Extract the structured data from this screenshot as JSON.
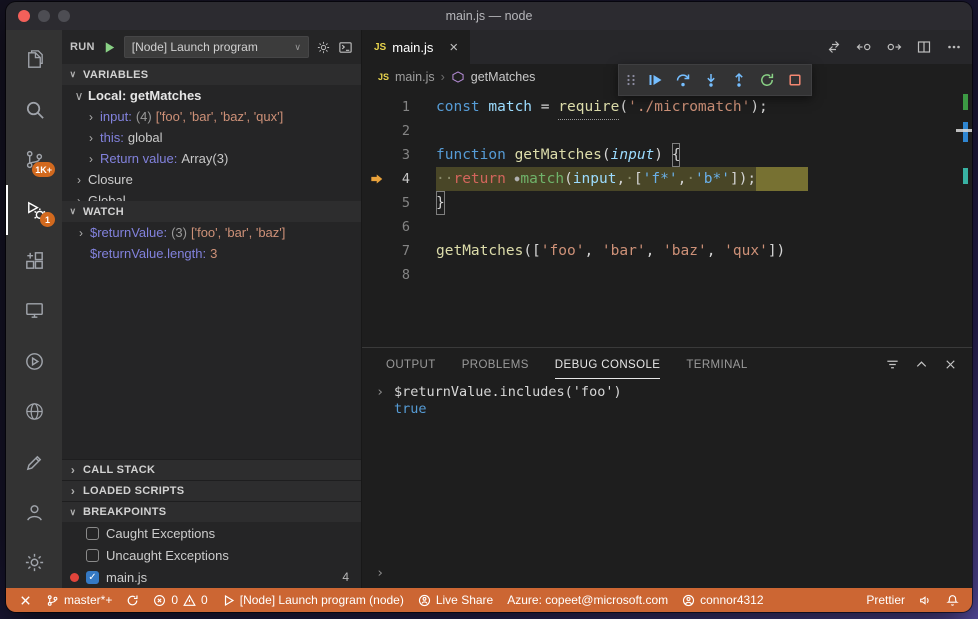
{
  "window": {
    "title": "main.js — node"
  },
  "colors": {
    "status_bar_debug": "#cc6633",
    "badge": "#d2691e",
    "current_line_highlight": "#53502a",
    "breakpoint_red": "#e0443b",
    "debug_step_blue": "#75beff",
    "restart_green": "#89d185",
    "stop_red": "#f48771"
  },
  "activity_bar": {
    "items": [
      {
        "icon": "explorer"
      },
      {
        "icon": "search"
      },
      {
        "icon": "source-control",
        "badge": "1K+"
      },
      {
        "icon": "debug",
        "badge": "1",
        "active": true
      },
      {
        "icon": "extensions"
      },
      {
        "icon": "remote-explorer"
      },
      {
        "icon": "run-circle"
      },
      {
        "icon": "globe"
      },
      {
        "icon": "edit-session"
      }
    ],
    "bottom_items": [
      {
        "icon": "account"
      },
      {
        "icon": "settings-gear"
      }
    ]
  },
  "run_bar": {
    "label": "RUN",
    "config": "[Node] Launch program"
  },
  "variables": {
    "header": "VARIABLES",
    "scope": "Local: getMatches",
    "rows": [
      {
        "name": "input:",
        "meta": "(4)",
        "value": "['foo', 'bar', 'baz', 'qux']",
        "vc": "str"
      },
      {
        "name": "this:",
        "meta": "",
        "value": "global",
        "vc": "pln"
      },
      {
        "name": "Return value:",
        "meta": "",
        "value": "Array(3)",
        "vc": "pln"
      }
    ],
    "closure": "Closure",
    "global": "Global"
  },
  "watch": {
    "header": "WATCH",
    "rows": [
      {
        "name": "$returnValue:",
        "meta": "(3)",
        "value": "['foo', 'bar', 'baz']",
        "vc": "str",
        "expandable": true
      },
      {
        "name": "$returnValue.length:",
        "meta": "",
        "value": "3",
        "vc": "str",
        "expandable": false
      }
    ]
  },
  "sections": {
    "call_stack": "CALL STACK",
    "loaded_scripts": "LOADED SCRIPTS",
    "breakpoints": "BREAKPOINTS"
  },
  "breakpoints": {
    "rows": [
      {
        "label": "Caught Exceptions",
        "checked": false
      },
      {
        "label": "Uncaught Exceptions",
        "checked": false
      },
      {
        "label": "main.js",
        "checked": true,
        "dot": true,
        "line": "4"
      }
    ]
  },
  "editor": {
    "tab_label": "main.js",
    "file_icon_text": "JS",
    "breadcrumb_file": "main.js",
    "breadcrumb_symbol": "getMatches",
    "editor_actions": [
      "open-changes",
      "previous-change",
      "next-change",
      "split-editor",
      "more-actions"
    ],
    "debug_toolbar": [
      "drag-handle",
      "continue",
      "step-over",
      "step-into",
      "step-out",
      "restart",
      "stop"
    ],
    "code_lines": [
      {
        "n": "1",
        "tokens": [
          {
            "t": "const ",
            "c": "kw"
          },
          {
            "t": "match",
            "c": "vardef"
          },
          {
            "t": " = ",
            "c": "pln"
          },
          {
            "t": "require",
            "c": "fn und"
          },
          {
            "t": "(",
            "c": "pln"
          },
          {
            "t": "'./micromatch'",
            "c": "str"
          },
          {
            "t": ");",
            "c": "pln"
          }
        ]
      },
      {
        "n": "2",
        "tokens": []
      },
      {
        "n": "3",
        "tokens": [
          {
            "t": "function ",
            "c": "kw"
          },
          {
            "t": "getMatches",
            "c": "fn"
          },
          {
            "t": "(",
            "c": "pln"
          },
          {
            "t": "input",
            "c": "param"
          },
          {
            "t": ") ",
            "c": "pln"
          },
          {
            "t": "{",
            "c": "pln bracket"
          }
        ]
      },
      {
        "n": "4",
        "hl": true,
        "tokens": [
          {
            "t": "··",
            "c": "ws"
          },
          {
            "t": "return ",
            "c": "ret"
          },
          {
            "t": "●",
            "c": "dot"
          },
          {
            "t": "match",
            "c": "green"
          },
          {
            "t": "(",
            "c": "pln"
          },
          {
            "t": "input",
            "c": "var"
          },
          {
            "t": ",",
            "c": "pln"
          },
          {
            "t": "·",
            "c": "ws"
          },
          {
            "t": "[",
            "c": "pln"
          },
          {
            "t": "'f*'",
            "c": "strblue"
          },
          {
            "t": ",",
            "c": "pln"
          },
          {
            "t": "·",
            "c": "ws"
          },
          {
            "t": "'b*'",
            "c": "strblue"
          },
          {
            "t": "]);",
            "c": "pln"
          }
        ]
      },
      {
        "n": "5",
        "tokens": [
          {
            "t": "}",
            "c": "pln bracket"
          }
        ]
      },
      {
        "n": "6",
        "tokens": []
      },
      {
        "n": "7",
        "tokens": [
          {
            "t": "getMatches",
            "c": "fn"
          },
          {
            "t": "([",
            "c": "pln"
          },
          {
            "t": "'foo'",
            "c": "str"
          },
          {
            "t": ", ",
            "c": "pln"
          },
          {
            "t": "'bar'",
            "c": "str"
          },
          {
            "t": ", ",
            "c": "pln"
          },
          {
            "t": "'baz'",
            "c": "str"
          },
          {
            "t": ", ",
            "c": "pln"
          },
          {
            "t": "'qux'",
            "c": "str"
          },
          {
            "t": "])",
            "c": "pln"
          }
        ]
      },
      {
        "n": "8",
        "tokens": []
      }
    ]
  },
  "panel": {
    "tabs": [
      {
        "label": "OUTPUT",
        "active": false
      },
      {
        "label": "PROBLEMS",
        "active": false
      },
      {
        "label": "DEBUG CONSOLE",
        "active": true
      },
      {
        "label": "TERMINAL",
        "active": false
      }
    ],
    "actions": [
      "filter",
      "collapse",
      "close-panel"
    ],
    "console_input": "$returnValue.includes('foo')",
    "console_result": "true"
  },
  "status_bar": {
    "branch": "master*+",
    "errors": "0",
    "warnings": "0",
    "debug_target": "[Node] Launch program (node)",
    "live_share": "Live Share",
    "azure": "Azure: copeet@microsoft.com",
    "account": "connor4312",
    "formatter": "Prettier"
  }
}
